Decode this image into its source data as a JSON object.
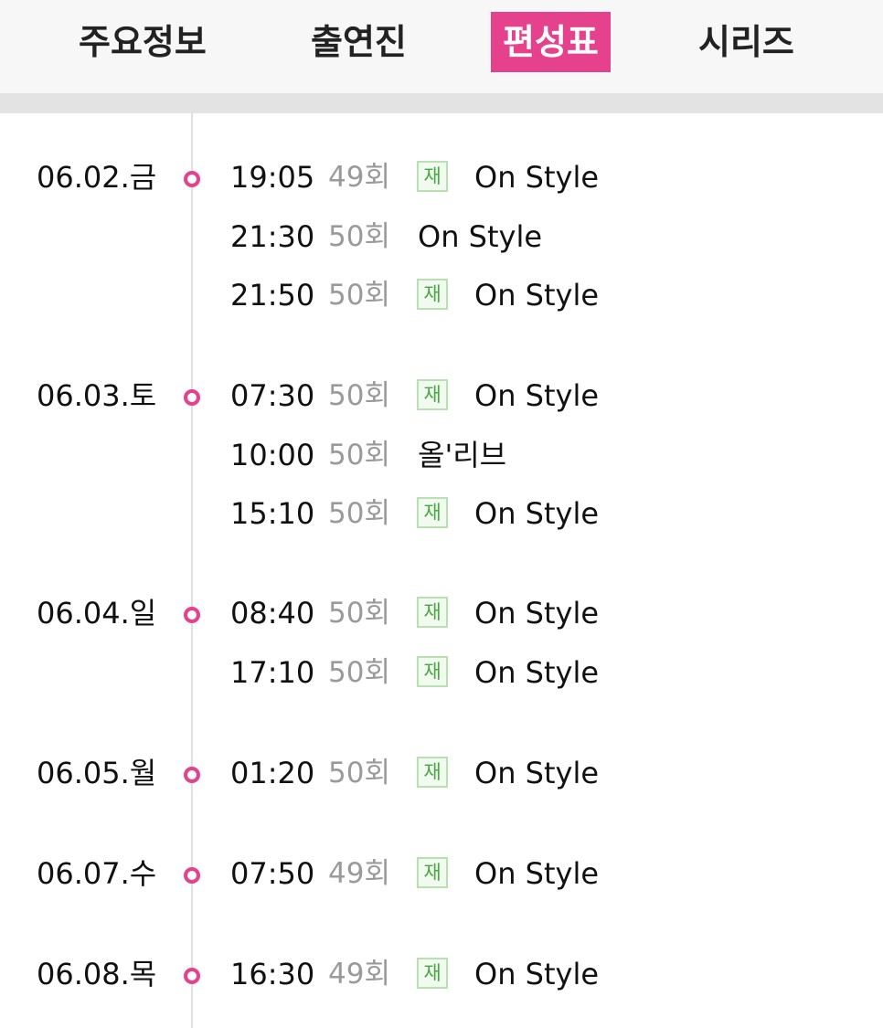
{
  "tabs": [
    {
      "label": "주요정보",
      "active": false
    },
    {
      "label": "출연진",
      "active": false
    },
    {
      "label": "편성표",
      "active": true
    },
    {
      "label": "시리즈",
      "active": false
    }
  ],
  "colors": {
    "accent": "#e6418d",
    "rerun_badge_text": "#4aa644",
    "episode_text": "#9a9a9a"
  },
  "rerun_badge_label": "재",
  "schedule": [
    {
      "date": "06.02.금",
      "airings": [
        {
          "time": "19:05",
          "episode": "49회",
          "rerun": true,
          "channel": "On Style"
        },
        {
          "time": "21:30",
          "episode": "50회",
          "rerun": false,
          "channel": "On Style"
        },
        {
          "time": "21:50",
          "episode": "50회",
          "rerun": true,
          "channel": "On Style"
        }
      ]
    },
    {
      "date": "06.03.토",
      "airings": [
        {
          "time": "07:30",
          "episode": "50회",
          "rerun": true,
          "channel": "On Style"
        },
        {
          "time": "10:00",
          "episode": "50회",
          "rerun": false,
          "channel": "올'리브"
        },
        {
          "time": "15:10",
          "episode": "50회",
          "rerun": true,
          "channel": "On Style"
        }
      ]
    },
    {
      "date": "06.04.일",
      "airings": [
        {
          "time": "08:40",
          "episode": "50회",
          "rerun": true,
          "channel": "On Style"
        },
        {
          "time": "17:10",
          "episode": "50회",
          "rerun": true,
          "channel": "On Style"
        }
      ]
    },
    {
      "date": "06.05.월",
      "airings": [
        {
          "time": "01:20",
          "episode": "50회",
          "rerun": true,
          "channel": "On Style"
        }
      ]
    },
    {
      "date": "06.07.수",
      "airings": [
        {
          "time": "07:50",
          "episode": "49회",
          "rerun": true,
          "channel": "On Style"
        }
      ]
    },
    {
      "date": "06.08.목",
      "airings": [
        {
          "time": "16:30",
          "episode": "49회",
          "rerun": true,
          "channel": "On Style"
        }
      ]
    }
  ]
}
